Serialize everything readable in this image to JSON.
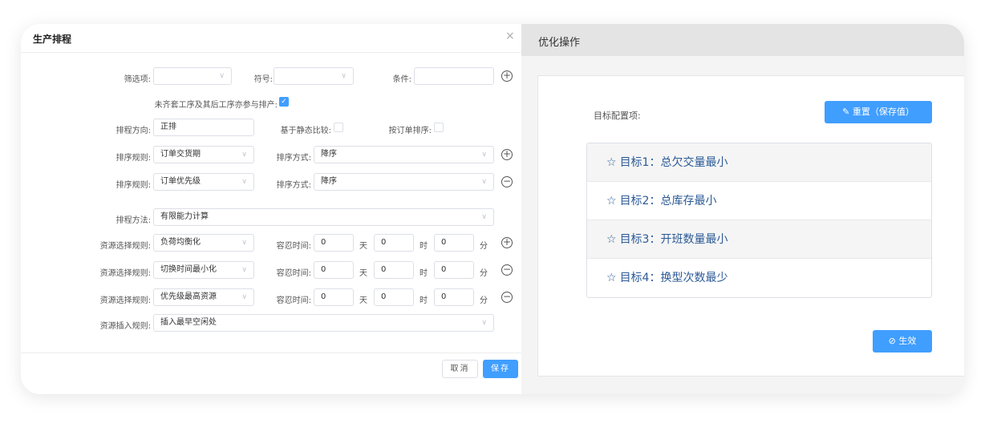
{
  "left_panel": {
    "title": "生产排程",
    "close": "×",
    "filter": {
      "field_label": "筛选项:",
      "symbol_label": "符号:",
      "condition_label": "条件:",
      "field_value": "",
      "symbol_value": "",
      "condition_value": ""
    },
    "incomplete_label": "未齐套工序及其后工序亦参与排产:",
    "incomplete_checked": true,
    "direction": {
      "label": "排程方向:",
      "value": "正排"
    },
    "static_compare_label": "基于静态比较:",
    "order_sort_label": "按订单排序:",
    "sort_rules": [
      {
        "label": "排序规则:",
        "value": "订单交货期",
        "method_label": "排序方式:",
        "method_value": "降序",
        "action": "plus"
      },
      {
        "label": "排序规则:",
        "value": "订单优先级",
        "method_label": "排序方式:",
        "method_value": "降序",
        "action": "minus"
      }
    ],
    "schedule_method": {
      "label": "排程方法:",
      "value": "有限能力计算"
    },
    "resource_rules": [
      {
        "label": "资源选择规则:",
        "value": "负荷均衡化",
        "tol_label": "容忍时间:",
        "day": "0",
        "hour": "0",
        "min": "0",
        "action": "plus"
      },
      {
        "label": "资源选择规则:",
        "value": "切换时间最小化",
        "tol_label": "容忍时间:",
        "day": "0",
        "hour": "0",
        "min": "0",
        "action": "minus"
      },
      {
        "label": "资源选择规则:",
        "value": "优先级最高资源",
        "tol_label": "容忍时间:",
        "day": "0",
        "hour": "0",
        "min": "0",
        "action": "minus"
      }
    ],
    "units": {
      "day": "天",
      "hour": "时",
      "min": "分"
    },
    "insert_rule": {
      "label": "资源插入规则:",
      "value": "插入最早空闲处"
    },
    "cancel_label": "取消",
    "save_label": "保存"
  },
  "right_panel": {
    "title": "优化操作",
    "target_label": "目标配置项:",
    "reset_label": "✎ 重置（保存值）",
    "goals": [
      "目标1：总欠交量最小",
      "目标2：总库存最小",
      "目标3：开班数量最小",
      "目标4：换型次数最少"
    ],
    "apply_label": "⊘ 生效"
  },
  "colors": {
    "primary": "#409eff",
    "goal_text": "#2c5a96"
  }
}
